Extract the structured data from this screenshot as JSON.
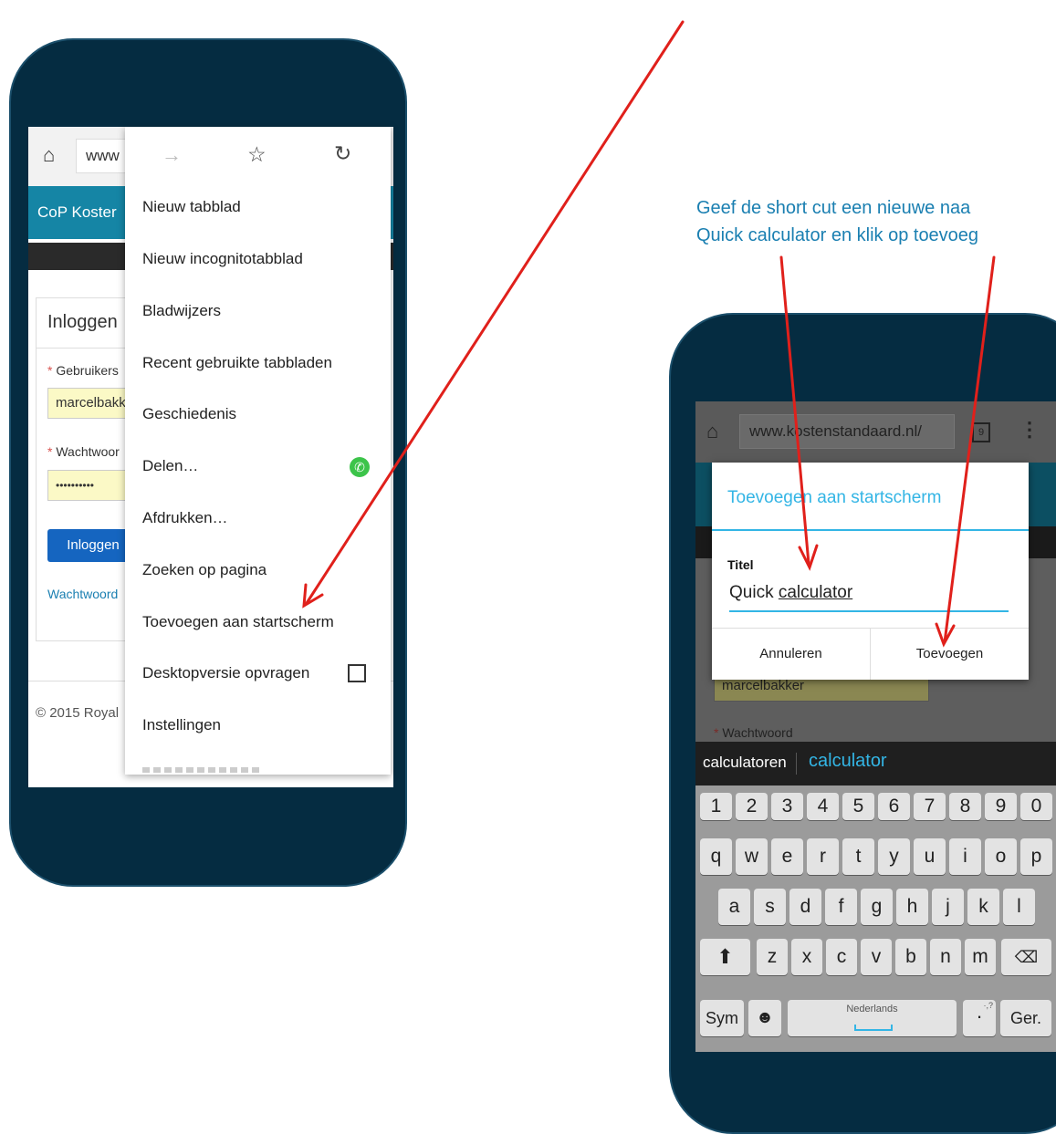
{
  "captions": {
    "right_line1": "Geef de short cut een nieuwe naa",
    "right_line2": "Quick calculator en klik op toevoeg"
  },
  "left": {
    "url_partial": "www",
    "site_title": "CoP Koster",
    "login_title": "Inloggen",
    "username_label": "Gebruikers",
    "username_value": "marcelbakk",
    "password_label": "Wachtwoor",
    "password_value": "••••••••••",
    "login_button": "Inloggen",
    "forgot_link": "Wachtwoord",
    "footer": "© 2015 Royal",
    "menu": {
      "items": [
        "Nieuw tabblad",
        "Nieuw incognitotabblad",
        "Bladwijzers",
        "Recent gebruikte tabbladen",
        "Geschiedenis",
        "Delen…",
        "Afdrukken…",
        "Zoeken op pagina",
        "Toevoegen aan startscherm",
        "Desktopversie opvragen",
        "Instellingen"
      ]
    }
  },
  "right": {
    "url": "www.kostenstandaard.nl/",
    "tab_count": "9",
    "dialog": {
      "title": "Toevoegen aan startscherm",
      "field_label": "Titel",
      "field_prefix": "Quick ",
      "field_underlined": "calculator",
      "cancel": "Annuleren",
      "confirm": "Toevoegen"
    },
    "behind": {
      "username_value": "marcelbakker",
      "password_label": "Wachtwoord"
    },
    "suggestions": [
      "calculatoren",
      "calculator"
    ],
    "keyboard": {
      "num_row": [
        "1",
        "2",
        "3",
        "4",
        "5",
        "6",
        "7",
        "8",
        "9",
        "0"
      ],
      "row1": [
        "q",
        "w",
        "e",
        "r",
        "t",
        "y",
        "u",
        "i",
        "o",
        "p"
      ],
      "row2": [
        "a",
        "s",
        "d",
        "f",
        "g",
        "h",
        "j",
        "k",
        "l"
      ],
      "row3": [
        "z",
        "x",
        "c",
        "v",
        "b",
        "n",
        "m"
      ],
      "sym": "Sym",
      "space_label": "Nederlands",
      "period": ".",
      "punct_hint": "·,?",
      "enter": "Ger."
    }
  },
  "colors": {
    "phone": "#052c41",
    "teal": "#1585a5",
    "caption": "#1a7fb1",
    "arrow": "#e0201b",
    "dialog_accent": "#33b5e5"
  }
}
